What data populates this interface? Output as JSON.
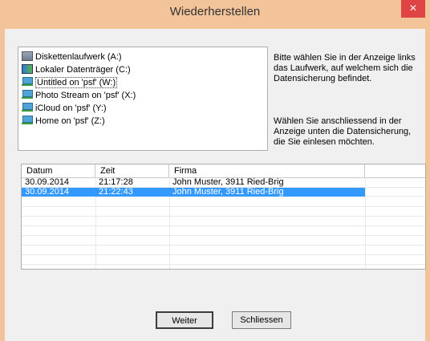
{
  "window": {
    "title": "Wiederherstellen",
    "close_glyph": "×"
  },
  "drives": [
    {
      "label": "Diskettenlaufwerk (A:)",
      "icon": "floppy-icon",
      "selected": false
    },
    {
      "label": "Lokaler Datenträger (C:)",
      "icon": "hard-drive-icon",
      "selected": false
    },
    {
      "label": "Untitled on 'psf' (W:)",
      "icon": "network-drive-icon",
      "selected": true
    },
    {
      "label": "Photo Stream on 'psf' (X:)",
      "icon": "network-drive-icon",
      "selected": false
    },
    {
      "label": "iCloud on 'psf' (Y:)",
      "icon": "network-drive-icon",
      "selected": false
    },
    {
      "label": "Home on 'psf' (Z:)",
      "icon": "network-drive-icon",
      "selected": false
    }
  ],
  "instructions": {
    "first": "Bitte wählen Sie in der Anzeige links das Laufwerk, auf welchem sich die Datensicherung befindet.",
    "second": "Wählen Sie anschliessend in der Anzeige unten die Datensicherung, die Sie einlesen möchten."
  },
  "table": {
    "columns": [
      "Datum",
      "Zeit",
      "Firma",
      ""
    ],
    "rows": [
      {
        "datum": "30.09.2014",
        "zeit": "21:17:28",
        "firma": "John Muster, 3911 Ried-Brig",
        "selected": false
      },
      {
        "datum": "30.09.2014",
        "zeit": "21:22:43",
        "firma": "John Muster, 3911 Ried-Brig",
        "selected": true
      }
    ]
  },
  "buttons": {
    "next": "Weiter",
    "close": "Schliessen"
  },
  "colors": {
    "title_bar": "#f3c49a",
    "close_button": "#e04343",
    "selection": "#3399ff"
  }
}
